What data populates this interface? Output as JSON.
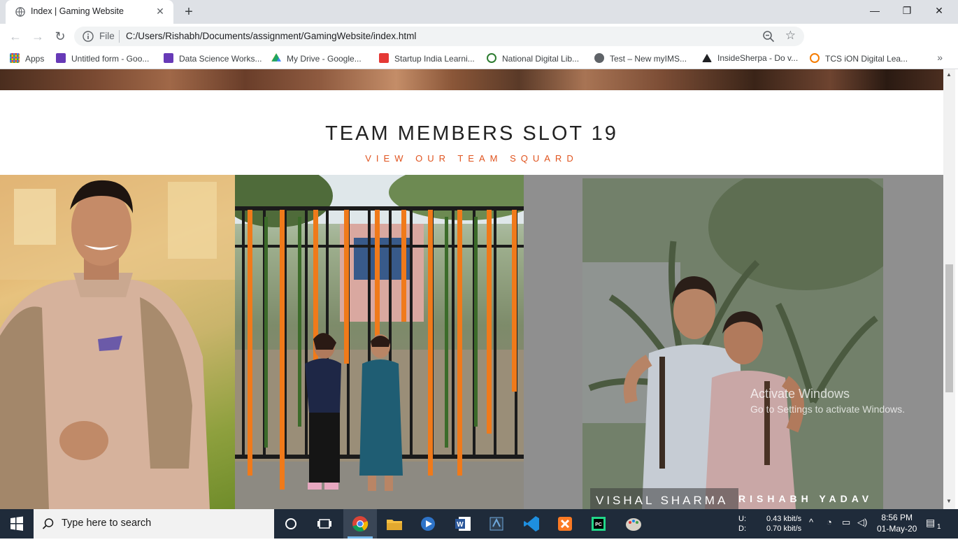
{
  "browser": {
    "tab_title": "Index | Gaming Website",
    "scheme": "File",
    "url": "C:/Users/Rishabh/Documents/assignment/GamingWebsite/index.html"
  },
  "bookmarks": [
    {
      "label": "Apps",
      "icon": "apps-grid-icon",
      "color": "#e8453c"
    },
    {
      "label": "Untitled form - Goo...",
      "icon": "google-forms-icon",
      "color": "#673ab7"
    },
    {
      "label": "Data Science Works...",
      "icon": "google-forms-icon",
      "color": "#673ab7"
    },
    {
      "label": "My Drive - Google...",
      "icon": "google-drive-icon",
      "color": "#1fa463"
    },
    {
      "label": "Startup India Learni...",
      "icon": "startup-india-icon",
      "color": "#e53935"
    },
    {
      "label": "National Digital Lib...",
      "icon": "ndl-icon",
      "color": "#2e7d32"
    },
    {
      "label": "Test – New myIMS...",
      "icon": "globe-icon",
      "color": "#5f6368"
    },
    {
      "label": "InsideSherpa - Do v...",
      "icon": "insidesherpa-icon",
      "color": "#202124"
    },
    {
      "label": "TCS iON Digital Lea...",
      "icon": "tcs-ion-icon",
      "color": "#f57c00"
    }
  ],
  "page": {
    "title": "TEAM MEMBERS SLOT 19",
    "subtitle": "VIEW OUR TEAM SQUARD",
    "members": [
      {
        "name": "VISHAL SHARMA"
      },
      {
        "name": "RISHABH YADAV"
      }
    ],
    "accent": "#e0541f"
  },
  "watermark": {
    "line1": "Activate Windows",
    "line2": "Go to Settings to activate Windows."
  },
  "taskbar": {
    "search_placeholder": "Type here to search",
    "net_up_label": "U:",
    "net_down_label": "D:",
    "net_up": "0.43 kbit/s",
    "net_down": "0.70 kbit/s",
    "time": "8:56 PM",
    "date": "01-May-20",
    "notifications": "1"
  }
}
